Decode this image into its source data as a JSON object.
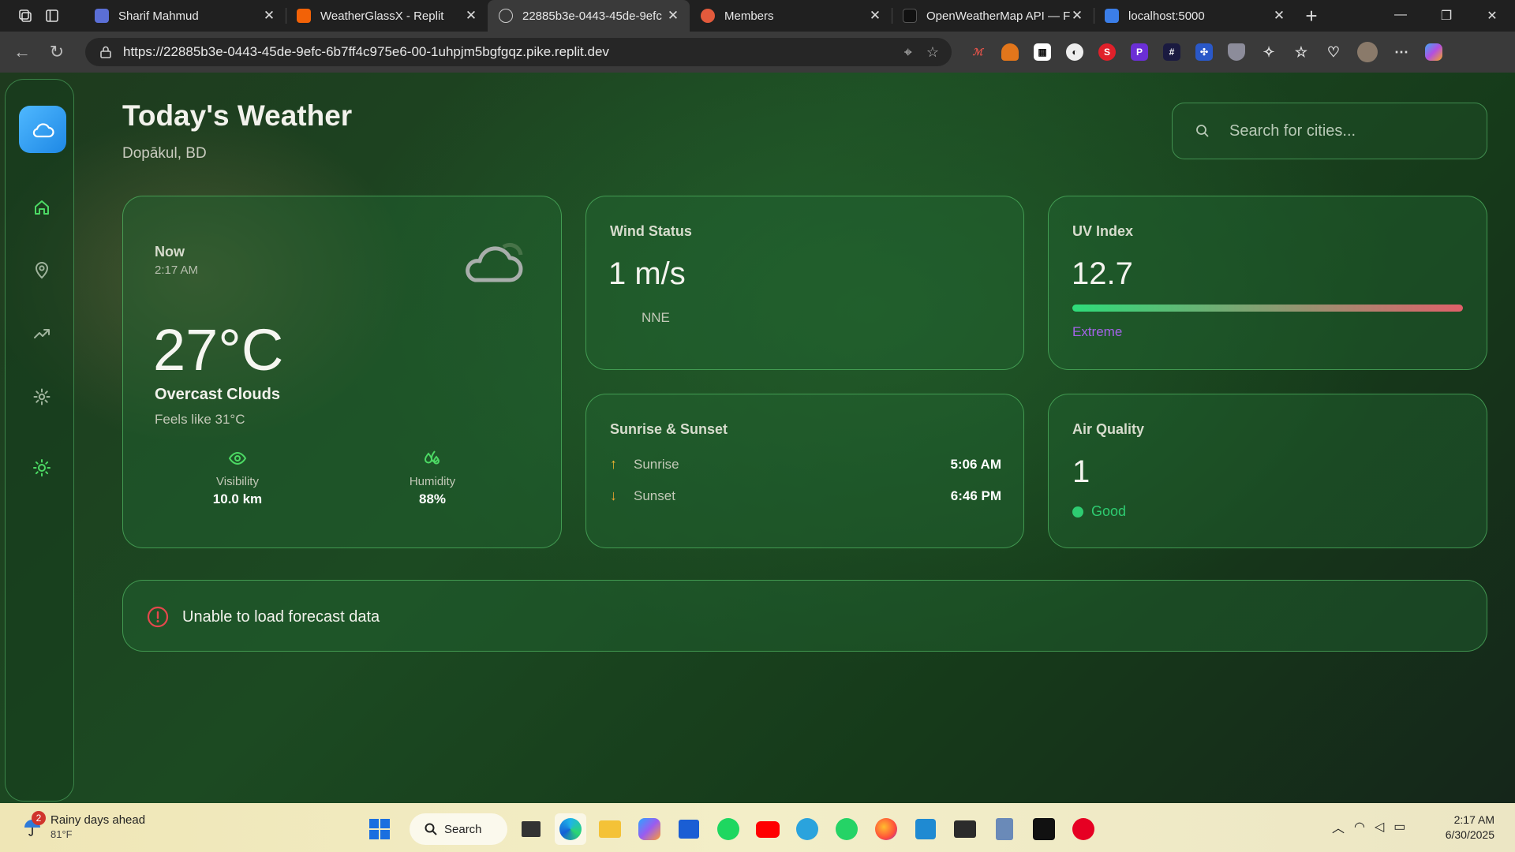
{
  "browser": {
    "tabs": [
      {
        "title": "Sharif Mahmud",
        "favicon": "#5b6fd6"
      },
      {
        "title": "WeatherGlassX - Replit",
        "favicon": "#f26207"
      },
      {
        "title": "22885b3e-0443-45de-9efc",
        "favicon": "#c8c8c8"
      },
      {
        "title": "Members",
        "favicon": "#e25a3c"
      },
      {
        "title": "OpenWeatherMap API — F",
        "favicon": "#111111"
      },
      {
        "title": "localhost:5000",
        "favicon": "#3b7ee8"
      }
    ],
    "url": "https://22885b3e-0443-45de-9efc-6b7ff4c975e6-00-1uhpjm5bgfgqz.pike.replit.dev"
  },
  "header": {
    "title": "Today's Weather",
    "location": "Dopākul, BD",
    "search_placeholder": "Search for cities..."
  },
  "now": {
    "label": "Now",
    "time": "2:17 AM",
    "temp": "27°C",
    "condition": "Overcast Clouds",
    "feels_like": "Feels like 31°C",
    "visibility_label": "Visibility",
    "visibility_value": "10.0 km",
    "humidity_label": "Humidity",
    "humidity_value": "88%"
  },
  "wind": {
    "label": "Wind Status",
    "speed": "1 m/s",
    "direction": "NNE"
  },
  "uv": {
    "label": "UV Index",
    "value": "12.7",
    "level": "Extreme",
    "level_color": "#a463e8"
  },
  "sun": {
    "label": "Sunrise & Sunset",
    "sunrise_label": "Sunrise",
    "sunrise": "5:06 AM",
    "sunset_label": "Sunset",
    "sunset": "6:46 PM"
  },
  "air": {
    "label": "Air Quality",
    "value": "1",
    "status": "Good",
    "status_color": "#2ecc71"
  },
  "error": {
    "message": "Unable to load forecast data"
  },
  "taskbar": {
    "weather_title": "Rainy days ahead",
    "weather_temp": "81°F",
    "badge": "2",
    "search_label": "Search",
    "time": "2:17 AM",
    "date": "6/30/2025"
  }
}
